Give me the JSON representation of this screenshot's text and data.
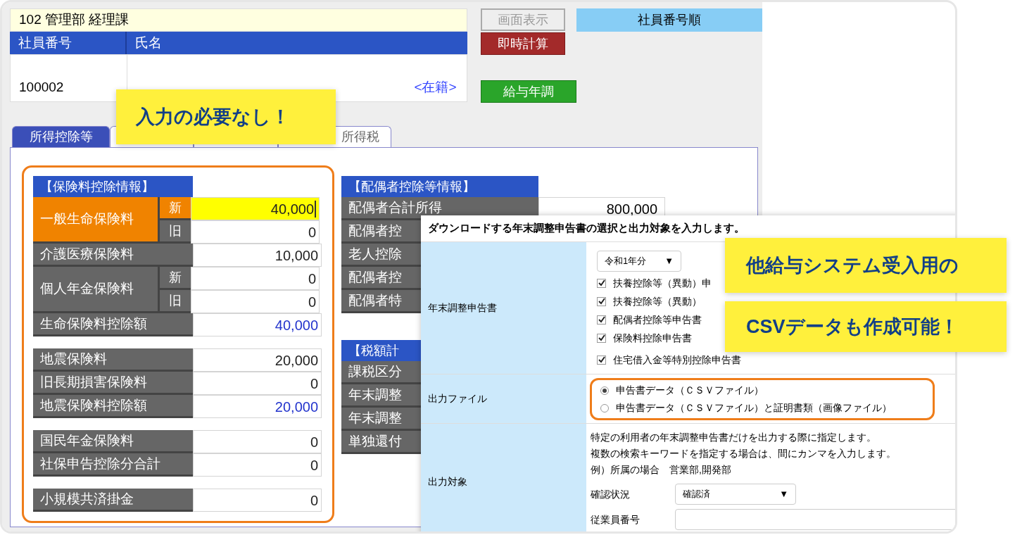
{
  "header": {
    "department": "102 管理部 経理課",
    "columns": [
      "社員番号",
      "氏名"
    ],
    "employee_number": "100002",
    "status": "<在籍>"
  },
  "buttons": [
    {
      "label": "画面表示",
      "kind": "disabled"
    },
    {
      "label": "即時計算",
      "kind": "danger"
    },
    {
      "label": "給与年調",
      "kind": "success"
    }
  ],
  "sort_label": "社員番号順",
  "tabs": [
    {
      "label": "所得控除等",
      "selected": true
    },
    {
      "selected": false
    },
    {
      "selected": false
    },
    {
      "label": "所得税",
      "selected": false
    }
  ],
  "insurance": {
    "title": "【保険料控除情報】",
    "groups": [
      {
        "rows": [
          {
            "kind": "split",
            "label": "一般生命保険料",
            "highlighted": true,
            "subs": [
              {
                "label": "新",
                "value": "40,000",
                "highlighted": true,
                "focused": true
              },
              {
                "label": "旧",
                "value": "0",
                "highlighted": false,
                "focused": false
              }
            ]
          },
          {
            "kind": "single",
            "label": "介護医療保険料",
            "value": "10,000",
            "computed": false
          },
          {
            "kind": "split",
            "label": "個人年金保険料",
            "highlighted": false,
            "subs": [
              {
                "label": "新",
                "value": "0",
                "highlighted": false,
                "focused": false
              },
              {
                "label": "旧",
                "value": "0",
                "highlighted": false,
                "focused": false
              }
            ]
          },
          {
            "kind": "single",
            "label": "生命保険料控除額",
            "value": "40,000",
            "computed": true
          }
        ]
      },
      {
        "rows": [
          {
            "kind": "single",
            "label": "地震保険料",
            "value": "20,000",
            "computed": false
          },
          {
            "kind": "single",
            "label": "旧長期損害保険料",
            "value": "0",
            "computed": false
          },
          {
            "kind": "single",
            "label": "地震保険料控除額",
            "value": "20,000",
            "computed": true
          }
        ]
      },
      {
        "rows": [
          {
            "kind": "single",
            "label": "国民年金保険料",
            "value": "0",
            "computed": false
          },
          {
            "kind": "single",
            "label": "社保申告控除分合計",
            "value": "0",
            "computed": false
          }
        ]
      },
      {
        "rows": [
          {
            "kind": "single",
            "label": "小規模共済掛金",
            "value": "0",
            "computed": false
          }
        ]
      }
    ]
  },
  "spouse": {
    "title": "【配偶者控除等情報】",
    "rows": [
      {
        "label": "配偶者合計所得",
        "value": "800,000"
      },
      {
        "label": "配偶者控"
      },
      {
        "label": "老人控除"
      },
      {
        "label": "配偶者控"
      },
      {
        "label": "配偶者特"
      }
    ]
  },
  "tax": {
    "title": "【税額計",
    "rows": [
      {
        "label": "課税区分"
      },
      {
        "label": "年末調整"
      },
      {
        "label": "年末調整"
      },
      {
        "label": "単独還付"
      }
    ]
  },
  "download_dialog": {
    "title": "ダウンロードする年末調整申告書の選択と出力対象を入力します。",
    "forms_label": "年末調整申告書",
    "year_select": "令和1年分",
    "year_arrow": "▼",
    "forms": [
      {
        "label": "扶養控除等（異動）申",
        "checked": true
      },
      {
        "label": "扶養控除等（異動）",
        "checked": true
      },
      {
        "label": "配偶者控除等申告書",
        "checked": true
      },
      {
        "label": "保険料控除申告書",
        "checked": true
      },
      {
        "label": "住宅借入金等特別控除申告書",
        "checked": true
      }
    ],
    "output_file_label": "出力ファイル",
    "output_files": [
      {
        "label": "申告書データ（ＣＳＶファイル）",
        "selected": true
      },
      {
        "label": "申告書データ（ＣＳＶファイル）と証明書類（画像ファイル）",
        "selected": false
      }
    ],
    "target_label": "出力対象",
    "target_help": [
      "特定の利用者の年末調整申告書だけを出力する際に指定します。",
      "複数の検索キーワードを指定する場合は、間にカンマを入力します。",
      "例）所属の場合　営業部,開発部"
    ],
    "status_label": "確認状況",
    "status_select": "確認済",
    "status_arrow": "▼",
    "employee_number_label": "従業員番号"
  },
  "callouts": [
    {
      "lines": [
        "入力の必要なし！"
      ]
    },
    {
      "lines": [
        "他給与システム受入用の",
        "CSVデータも作成可能！"
      ]
    }
  ]
}
